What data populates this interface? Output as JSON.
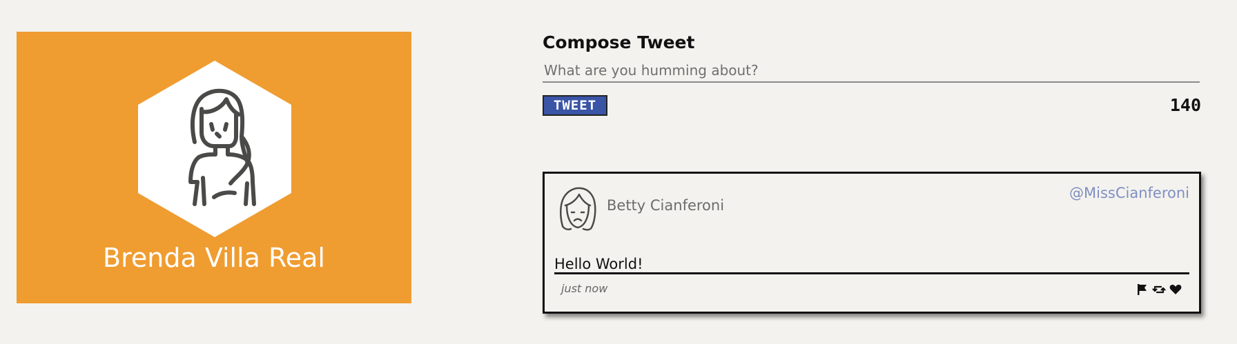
{
  "profile": {
    "name": "Brenda Villa Real",
    "icon": "woman-avatar-icon",
    "background_color": "#ef9c31"
  },
  "compose": {
    "title": "Compose Tweet",
    "input_placeholder": "What are you humming about?",
    "input_value": "",
    "tweet_button_label": "TWEET",
    "char_count": "140",
    "button_color": "#3a54a6"
  },
  "tweet": {
    "author": "Betty Cianferoni",
    "handle": "@MissCianferoni",
    "body": "Hello World!",
    "time": "just now",
    "avatar_icon": "woman-face-icon",
    "actions": [
      "flag-icon",
      "retweet-icon",
      "heart-icon"
    ],
    "handle_color": "#7e8fc2"
  }
}
